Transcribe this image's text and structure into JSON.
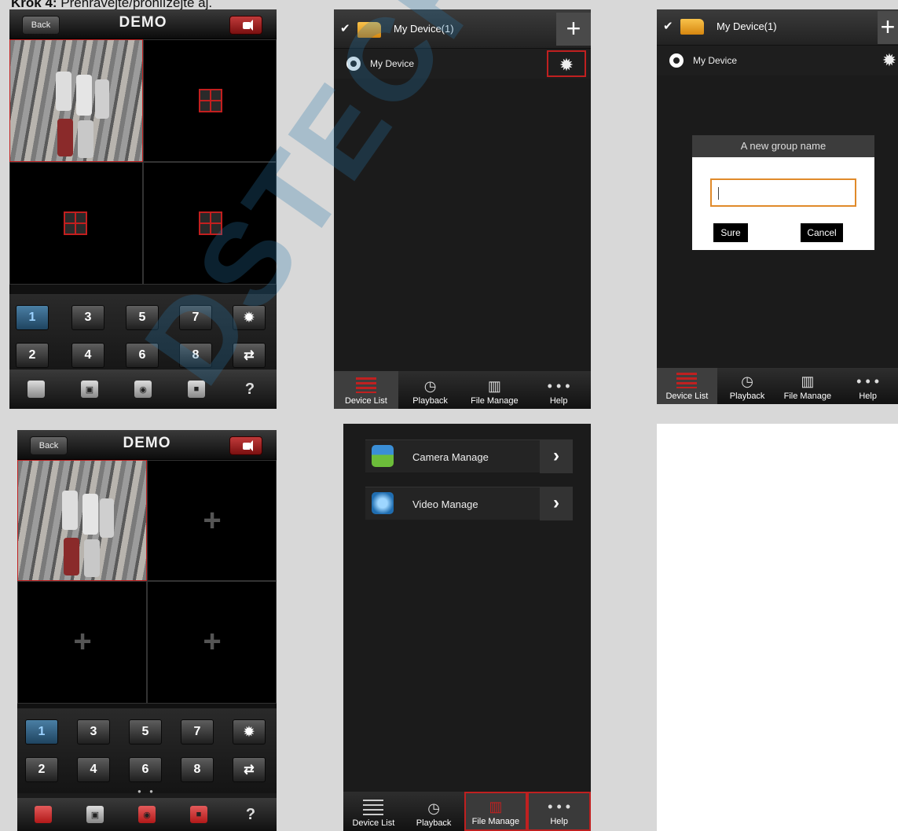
{
  "caption": {
    "bold": "Krok 4:",
    "rest": " Přehrávejte/prohlížejte aj."
  },
  "live": {
    "back_label": "Back",
    "title": "DEMO",
    "keys": [
      "1",
      "3",
      "5",
      "7",
      "2",
      "4",
      "6",
      "8"
    ],
    "page_dots": "● ●",
    "help_label": "?"
  },
  "device_list": {
    "group_label": "My Device(1)",
    "device_label": "My Device",
    "add_label": "+"
  },
  "dialog": {
    "title": "A new group name",
    "input_value": "",
    "sure_label": "Sure",
    "cancel_label": "Cancel"
  },
  "nav": {
    "device_list": "Device List",
    "playback": "Playback",
    "file_manage": "File Manage",
    "help": "Help"
  },
  "file_manage": {
    "camera_manage": "Camera Manage",
    "video_manage": "Video Manage"
  },
  "watermark": "DSTECHNIK.cz"
}
